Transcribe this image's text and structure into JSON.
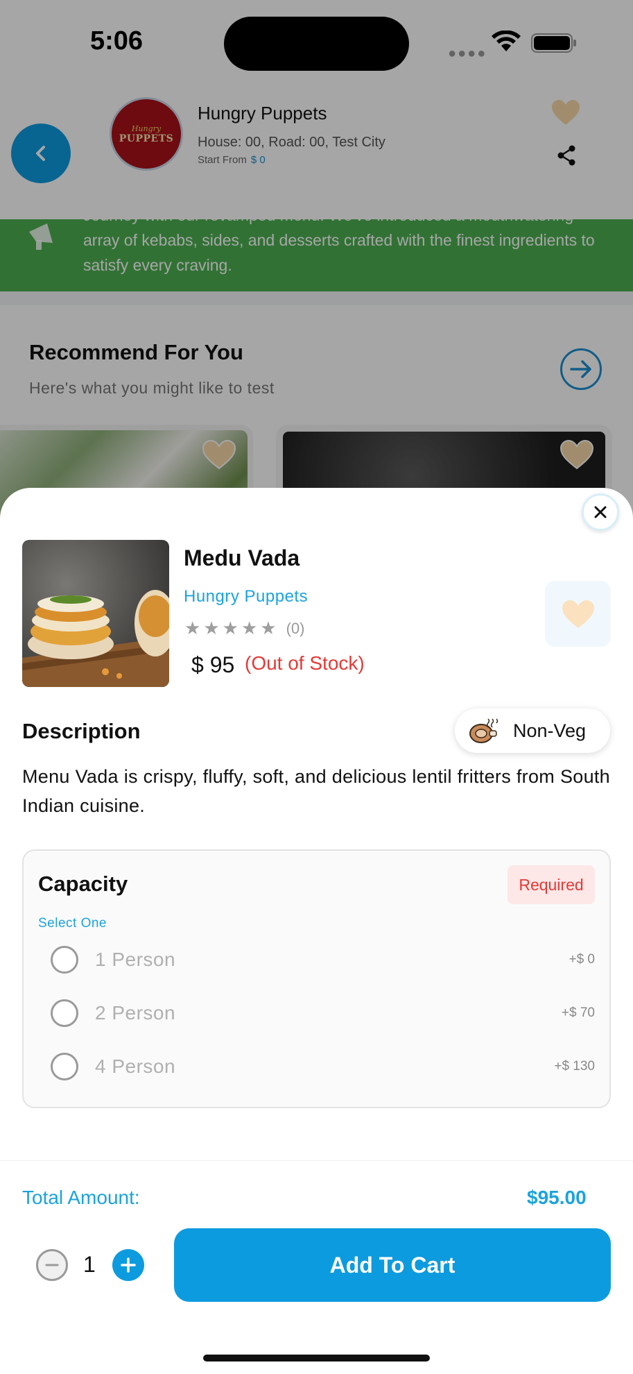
{
  "status_bar": {
    "time": "5:06"
  },
  "restaurant": {
    "logo_line1": "Hungry",
    "logo_line2": "PUPPETS",
    "name": "Hungry Puppets",
    "address": "House: 00, Road: 00, Test City",
    "start_from_label": "Start From",
    "start_from_price": "$ 0"
  },
  "banner": {
    "text": "Journey with our revamped menu! We've introduced a mouthwatering array of kebabs, sides, and desserts crafted with the finest ingredients to satisfy every craving."
  },
  "recommend": {
    "title": "Recommend For You",
    "subtitle": "Here's what you might like to test"
  },
  "product": {
    "name": "Medu Vada",
    "restaurant": "Hungry Puppets",
    "rating_count": "(0)",
    "rating": 0,
    "price": "$ 95",
    "stock_status": "(Out of Stock)",
    "diet_tag": "Non-Veg"
  },
  "description": {
    "title": "Description",
    "text": "Menu Vada is crispy, fluffy, soft, and delicious lentil fritters from South Indian cuisine."
  },
  "capacity": {
    "title": "Capacity",
    "required_label": "Required",
    "hint": "Select One",
    "options": [
      {
        "label": "1 Person",
        "price": "+$ 0"
      },
      {
        "label": "2 Person",
        "price": "+$ 70"
      },
      {
        "label": "4 Person",
        "price": "+$ 130"
      }
    ]
  },
  "footer": {
    "total_label": "Total Amount:",
    "total_value": "$95.00",
    "quantity": "1",
    "add_to_cart_label": "Add To Cart"
  },
  "colors": {
    "primary": "#0d9bdf",
    "accent_text": "#1aa3de",
    "banner_green": "#4caf50",
    "out_of_stock": "#e53935"
  },
  "icons": [
    "back-icon",
    "heart-icon",
    "share-icon",
    "arrow-right-icon",
    "close-icon",
    "star-icon",
    "non-veg-icon",
    "minus-icon",
    "plus-icon"
  ]
}
